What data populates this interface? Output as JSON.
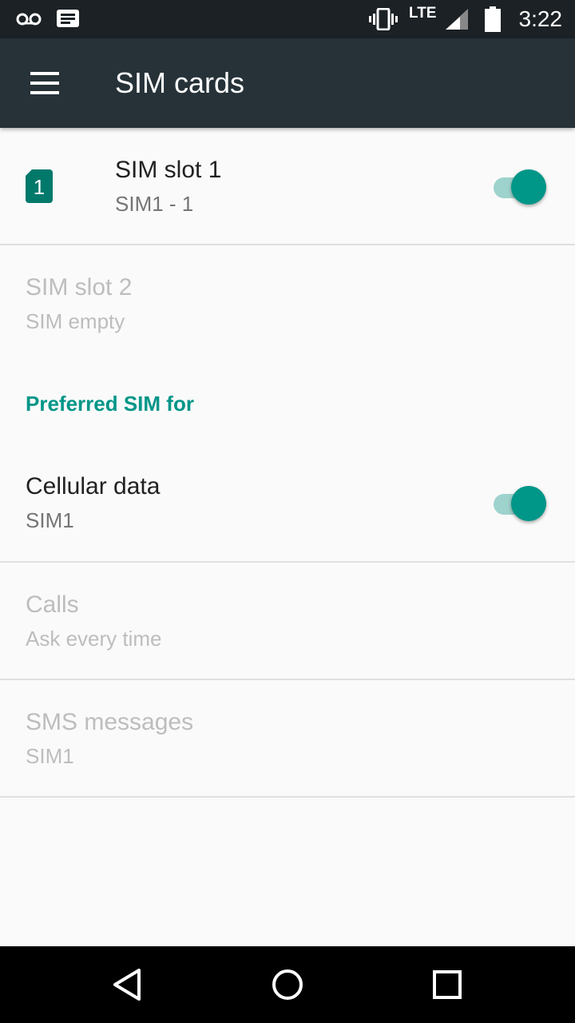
{
  "status_bar": {
    "time": "3:22",
    "network": "LTE",
    "icons": [
      "voicemail-icon",
      "message-icon",
      "vibrate-icon",
      "signal-icon",
      "battery-icon"
    ]
  },
  "app_bar": {
    "title": "SIM cards",
    "menu_icon": "hamburger-menu-icon"
  },
  "sim_slots": [
    {
      "title": "SIM slot 1",
      "summary": "SIM1 - 1",
      "badge": "1",
      "enabled": true,
      "switch_on": true
    },
    {
      "title": "SIM slot 2",
      "summary": "SIM empty",
      "enabled": false
    }
  ],
  "preferred": {
    "header": "Preferred SIM for",
    "items": [
      {
        "title": "Cellular data",
        "summary": "SIM1",
        "enabled": true,
        "switch_on": true
      },
      {
        "title": "Calls",
        "summary": "Ask every time",
        "enabled": false
      },
      {
        "title": "SMS messages",
        "summary": "SIM1",
        "enabled": false
      }
    ]
  },
  "nav_bar": {
    "buttons": [
      "back-icon",
      "home-icon",
      "recents-icon"
    ]
  },
  "colors": {
    "accent": "#009688",
    "app_bar": "#263238",
    "status_bar": "#1b2125"
  }
}
